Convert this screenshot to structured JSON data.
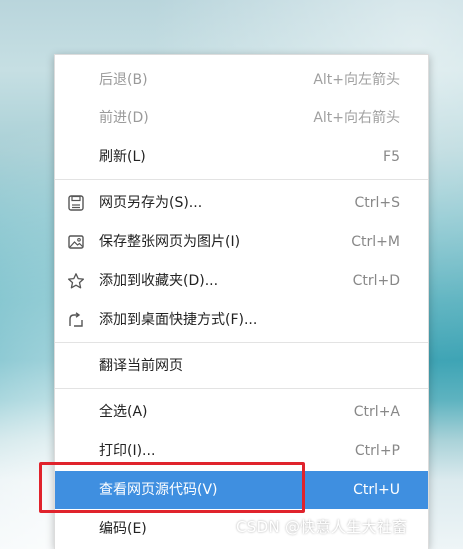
{
  "context_menu": {
    "items": [
      {
        "label": "后退(B)",
        "shortcut": "Alt+向左箭头",
        "disabled": true
      },
      {
        "label": "前进(D)",
        "shortcut": "Alt+向右箭头",
        "disabled": true
      },
      {
        "label": "刷新(L)",
        "shortcut": "F5"
      },
      {
        "label": "网页另存为(S)...",
        "shortcut": "Ctrl+S",
        "icon": "save-icon"
      },
      {
        "label": "保存整张网页为图片(I)",
        "shortcut": "Ctrl+M",
        "icon": "image-icon"
      },
      {
        "label": "添加到收藏夹(D)...",
        "shortcut": "Ctrl+D",
        "icon": "star-icon"
      },
      {
        "label": "添加到桌面快捷方式(F)...",
        "shortcut": "",
        "icon": "shortcut-icon"
      },
      {
        "label": "翻译当前网页",
        "shortcut": ""
      },
      {
        "label": "全选(A)",
        "shortcut": "Ctrl+A"
      },
      {
        "label": "打印(I)...",
        "shortcut": "Ctrl+P"
      },
      {
        "label": "查看网页源代码(V)",
        "shortcut": "Ctrl+U",
        "highlighted": true
      },
      {
        "label": "编码(E)",
        "shortcut": ""
      }
    ]
  },
  "watermark": "CSDN @快意人生大社畜",
  "colors": {
    "highlight": "#3f8fe0",
    "annotation_box": "#e0232c"
  }
}
